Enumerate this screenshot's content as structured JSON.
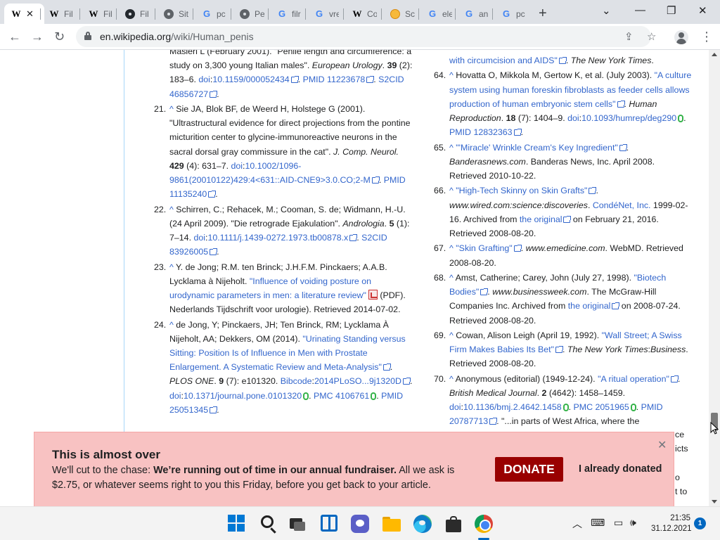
{
  "browser": {
    "tabs": [
      {
        "favicon": "wikipedia-icon",
        "title": "W"
      },
      {
        "favicon": "wikipedia-icon",
        "title": "Fil"
      },
      {
        "favicon": "wikipedia-icon",
        "title": "Fil"
      },
      {
        "favicon": "github-icon",
        "title": "Fil"
      },
      {
        "favicon": "globe-icon",
        "title": "Sit"
      },
      {
        "favicon": "google-icon",
        "title": "pc"
      },
      {
        "favicon": "globe-icon",
        "title": "Pe"
      },
      {
        "favicon": "google-icon",
        "title": "filr"
      },
      {
        "favicon": "google-icon",
        "title": "vre"
      },
      {
        "favicon": "wikipedia-icon",
        "title": "Co"
      },
      {
        "favicon": "coin-icon",
        "title": "Sc"
      },
      {
        "favicon": "google-icon",
        "title": "ele"
      },
      {
        "favicon": "google-icon",
        "title": "an"
      },
      {
        "favicon": "google-icon",
        "title": "pc"
      }
    ],
    "url_host": "en.wikipedia.org",
    "url_path": "/wiki/Human_penis"
  },
  "references_left": [
    {
      "num": "",
      "html_parts": [
        {
          "t": "Masieri L (February 2001). \"Penile length and circumference: a study on 3,300 young Italian males\". "
        },
        {
          "t": "European Urology",
          "i": true
        },
        {
          "t": ". "
        },
        {
          "t": "39",
          "b": true
        },
        {
          "t": " (2): 183–6. "
        },
        {
          "t": "doi",
          "a": true
        },
        {
          "t": ":"
        },
        {
          "t": "10.1159/000052434",
          "a": true,
          "ext": true
        },
        {
          "t": ". "
        },
        {
          "t": "PMID",
          "a": true
        },
        {
          "t": " "
        },
        {
          "t": "11223678",
          "a": true,
          "ext": true
        },
        {
          "t": ". "
        },
        {
          "t": "S2CID",
          "a": true
        },
        {
          "t": " "
        },
        {
          "t": "46856727",
          "a": true,
          "ext": true
        },
        {
          "t": "."
        }
      ]
    },
    {
      "num": "21.",
      "html_parts": [
        {
          "t": "^",
          "a": true
        },
        {
          "t": " Sie JA, Blok BF, de Weerd H, Holstege G (2001). \"Ultrastructural evidence for direct projections from the pontine micturition center to glycine-immunoreactive neurons in the sacral dorsal gray commissure in the cat\". "
        },
        {
          "t": "J. Comp. Neurol.",
          "i": true
        },
        {
          "t": " "
        },
        {
          "t": "429",
          "b": true
        },
        {
          "t": " (4): 631–7. "
        },
        {
          "t": "doi",
          "a": true
        },
        {
          "t": ":"
        },
        {
          "t": "10.1002/1096-9861(20010122)429:4<631::AID-CNE9>3.0.CO;2-M",
          "a": true,
          "ext": true
        },
        {
          "t": ". "
        },
        {
          "t": "PMID",
          "a": true
        },
        {
          "t": " "
        },
        {
          "t": "11135240",
          "a": true,
          "ext": true
        },
        {
          "t": "."
        }
      ]
    },
    {
      "num": "22.",
      "html_parts": [
        {
          "t": "^",
          "a": true
        },
        {
          "t": " Schirren, C.; Rehacek, M.; Cooman, S. de; Widmann, H.-U. (24 April 2009). \"Die retrograde Ejakulation\". "
        },
        {
          "t": "Andrologia",
          "i": true
        },
        {
          "t": ". "
        },
        {
          "t": "5",
          "b": true
        },
        {
          "t": " (1): 7–14. "
        },
        {
          "t": "doi",
          "a": true
        },
        {
          "t": ":"
        },
        {
          "t": "10.1111/j.1439-0272.1973.tb00878.x",
          "a": true,
          "ext": true
        },
        {
          "t": ". "
        },
        {
          "t": "S2CID",
          "a": true
        },
        {
          "t": " "
        },
        {
          "t": "83926005",
          "a": true,
          "ext": true
        },
        {
          "t": "."
        }
      ]
    },
    {
      "num": "23.",
      "html_parts": [
        {
          "t": "^",
          "a": true
        },
        {
          "t": " Y. de Jong; R.M. ten Brinck; J.H.F.M. Pinckaers; A.A.B. Lycklama à Nijeholt. "
        },
        {
          "t": "\"Influence of voiding posture on urodynamic parameters in men: a literature review\"",
          "a": true,
          "pdf": true
        },
        {
          "t": " (PDF). Nederlands Tijdschrift voor urologie). Retrieved 2014-07-02."
        }
      ]
    },
    {
      "num": "24.",
      "html_parts": [
        {
          "t": "^",
          "a": true
        },
        {
          "t": " de Jong, Y; Pinckaers, JH; Ten Brinck, RM; Lycklama À Nijeholt, AA; Dekkers, OM (2014). "
        },
        {
          "t": "\"Urinating Standing versus Sitting: Position Is of Influence in Men with Prostate Enlargement. A Systematic Review and Meta-Analysis\"",
          "a": true,
          "ext": true
        },
        {
          "t": ". "
        },
        {
          "t": "PLOS ONE",
          "i": true
        },
        {
          "t": ". "
        },
        {
          "t": "9",
          "b": true
        },
        {
          "t": " (7): e101320. "
        },
        {
          "t": "Bibcode",
          "a": true
        },
        {
          "t": ":"
        },
        {
          "t": "2014PLoSO...9j1320D",
          "a": true,
          "ext": true
        },
        {
          "t": ". "
        },
        {
          "t": "doi",
          "a": true
        },
        {
          "t": ":"
        },
        {
          "t": "10.1371/journal.pone.0101320",
          "a": true,
          "oa": true
        },
        {
          "t": ". "
        },
        {
          "t": "PMC",
          "a": true
        },
        {
          "t": " "
        },
        {
          "t": "4106761",
          "a": true,
          "oa": true
        },
        {
          "t": ". "
        },
        {
          "t": "PMID",
          "a": true
        },
        {
          "t": " "
        },
        {
          "t": "25051345",
          "a": true,
          "ext": true
        },
        {
          "t": "."
        }
      ]
    }
  ],
  "references_right": [
    {
      "num": "",
      "html_parts": [
        {
          "t": "with circumcision and AIDS\"",
          "a": true,
          "ext": true
        },
        {
          "t": ". "
        },
        {
          "t": "The New York Times",
          "i": true
        },
        {
          "t": "."
        }
      ]
    },
    {
      "num": "64.",
      "html_parts": [
        {
          "t": "^",
          "a": true
        },
        {
          "t": " Hovatta O, Mikkola M, Gertow K, et al. (July 2003). "
        },
        {
          "t": "\"A culture system using human foreskin fibroblasts as feeder cells allows production of human embryonic stem cells\"",
          "a": true,
          "ext": true
        },
        {
          "t": ". "
        },
        {
          "t": "Human Reproduction",
          "i": true
        },
        {
          "t": ". "
        },
        {
          "t": "18",
          "b": true
        },
        {
          "t": " (7): 1404–9. "
        },
        {
          "t": "doi",
          "a": true
        },
        {
          "t": ":"
        },
        {
          "t": "10.1093/humrep/deg290",
          "a": true,
          "oa": true
        },
        {
          "t": ". "
        },
        {
          "t": "PMID",
          "a": true
        },
        {
          "t": " "
        },
        {
          "t": "12832363",
          "a": true,
          "ext": true
        },
        {
          "t": "."
        }
      ]
    },
    {
      "num": "65.",
      "html_parts": [
        {
          "t": "^",
          "a": true
        },
        {
          "t": " "
        },
        {
          "t": "\"'Miracle' Wrinkle Cream's Key Ingredient\"",
          "a": true,
          "ext": true
        },
        {
          "t": ". "
        },
        {
          "t": "Banderasnews.com",
          "i": true
        },
        {
          "t": ". Banderas News, Inc. April 2008. Retrieved 2010-10-22."
        }
      ]
    },
    {
      "num": "66.",
      "html_parts": [
        {
          "t": "^",
          "a": true
        },
        {
          "t": " "
        },
        {
          "t": "\"High-Tech Skinny on Skin Grafts\"",
          "a": true,
          "ext": true
        },
        {
          "t": ". "
        },
        {
          "t": "www.wired.com:science:discoveries",
          "i": true
        },
        {
          "t": ". "
        },
        {
          "t": "CondéNet, Inc.",
          "a": true
        },
        {
          "t": " 1999-02-16. Archived from "
        },
        {
          "t": "the original",
          "a": true,
          "ext": true
        },
        {
          "t": " on February 21, 2016. Retrieved 2008-08-20."
        }
      ]
    },
    {
      "num": "67.",
      "html_parts": [
        {
          "t": "^",
          "a": true
        },
        {
          "t": " "
        },
        {
          "t": "\"Skin Grafting\"",
          "a": true,
          "ext": true
        },
        {
          "t": ". "
        },
        {
          "t": "www.emedicine.com",
          "i": true
        },
        {
          "t": ". WebMD. Retrieved 2008-08-20."
        }
      ]
    },
    {
      "num": "68.",
      "html_parts": [
        {
          "t": "^",
          "a": true
        },
        {
          "t": " Amst, Catherine; Carey, John (July 27, 1998). "
        },
        {
          "t": "\"Biotech Bodies\"",
          "a": true,
          "ext": true
        },
        {
          "t": ". "
        },
        {
          "t": "www.businessweek.com",
          "i": true
        },
        {
          "t": ". The McGraw-Hill Companies Inc. Archived from "
        },
        {
          "t": "the original",
          "a": true,
          "ext": true
        },
        {
          "t": " on 2008-07-24. Retrieved 2008-08-20."
        }
      ]
    },
    {
      "num": "69.",
      "html_parts": [
        {
          "t": "^",
          "a": true
        },
        {
          "t": " Cowan, Alison Leigh (April 19, 1992). "
        },
        {
          "t": "\"Wall Street; A Swiss Firm Makes Babies Its Bet\"",
          "a": true,
          "ext": true
        },
        {
          "t": ". "
        },
        {
          "t": "The New York Times",
          "i": true
        },
        {
          "t": ":"
        },
        {
          "t": "Business",
          "i": true
        },
        {
          "t": ". Retrieved 2008-08-20."
        }
      ]
    },
    {
      "num": "70.",
      "html_parts": [
        {
          "t": "^",
          "a": true
        },
        {
          "t": " Anonymous (editorial) (1949-12-24). "
        },
        {
          "t": "\"A ritual operation\"",
          "a": true,
          "ext": true
        },
        {
          "t": ". "
        },
        {
          "t": "British Medical Journal",
          "i": true
        },
        {
          "t": ". "
        },
        {
          "t": "2",
          "b": true
        },
        {
          "t": " (4642): 1458–1459. "
        },
        {
          "t": "doi",
          "a": true
        },
        {
          "t": ":"
        },
        {
          "t": "10.1136/bmj.2.4642.1458",
          "a": true,
          "oa": true
        },
        {
          "t": ". "
        },
        {
          "t": "PMC",
          "a": true
        },
        {
          "t": " "
        },
        {
          "t": "2051965",
          "a": true,
          "oa": true
        },
        {
          "t": ". "
        },
        {
          "t": "PMID",
          "a": true
        },
        {
          "t": " "
        },
        {
          "t": "20787713",
          "a": true,
          "ext": true
        },
        {
          "t": ". \"...in parts of West Africa, where the"
        }
      ]
    }
  ],
  "banner": {
    "title": "This is almost over",
    "text_lead": "We'll cut to the chase: ",
    "text_bold": "We’re running out of time in our annual fundraiser.",
    "text_rest": " All we ask is $2.75, or whatever seems right to you this Friday, before you get back to your article.",
    "donate_label": "DONATE",
    "donated_label": "I already donated",
    "behind_fragments": [
      "ce",
      "icts",
      "o",
      "t to"
    ]
  },
  "taskbar": {
    "time": "21:35",
    "date": "31.12.2021",
    "notifications": "1"
  }
}
